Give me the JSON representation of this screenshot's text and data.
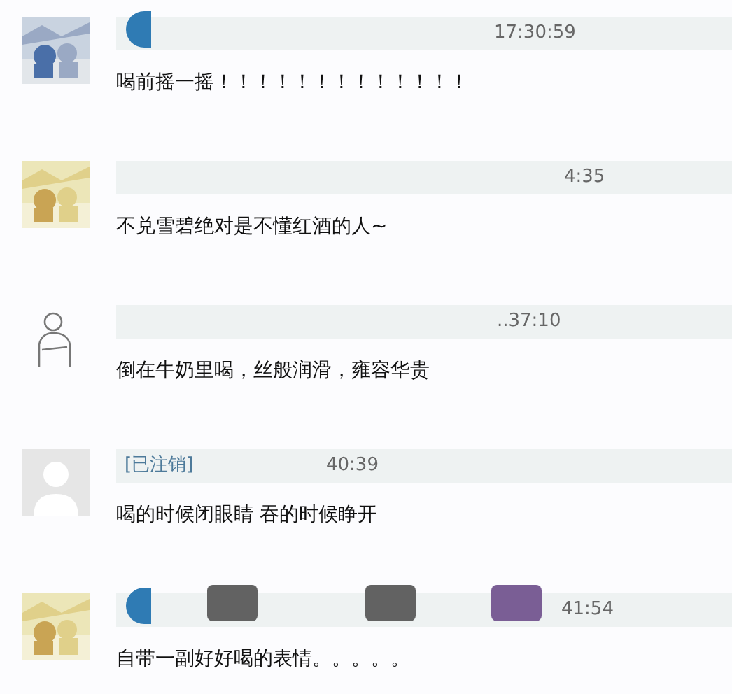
{
  "comments": [
    {
      "time": "17:30:59",
      "text": "喝前摇一摇！！！！！！！！！！！！！"
    },
    {
      "time": "4:35",
      "text": "不兑雪碧绝对是不懂红酒的人~"
    },
    {
      "avatar": {
        "kind": "sketch"
      },
      "time": "..37:10",
      "text": "倒在牛奶里喝，丝般润滑，雍容华贵"
    },
    {
      "avatar": {
        "kind": "default"
      },
      "name": "[已注销]",
      "time": "40:39",
      "text": "喝的时候闭眼睛 吞的时候睁开"
    },
    {
      "time": "41:54",
      "text": "自带一副好好喝的表情。。。。。"
    }
  ]
}
